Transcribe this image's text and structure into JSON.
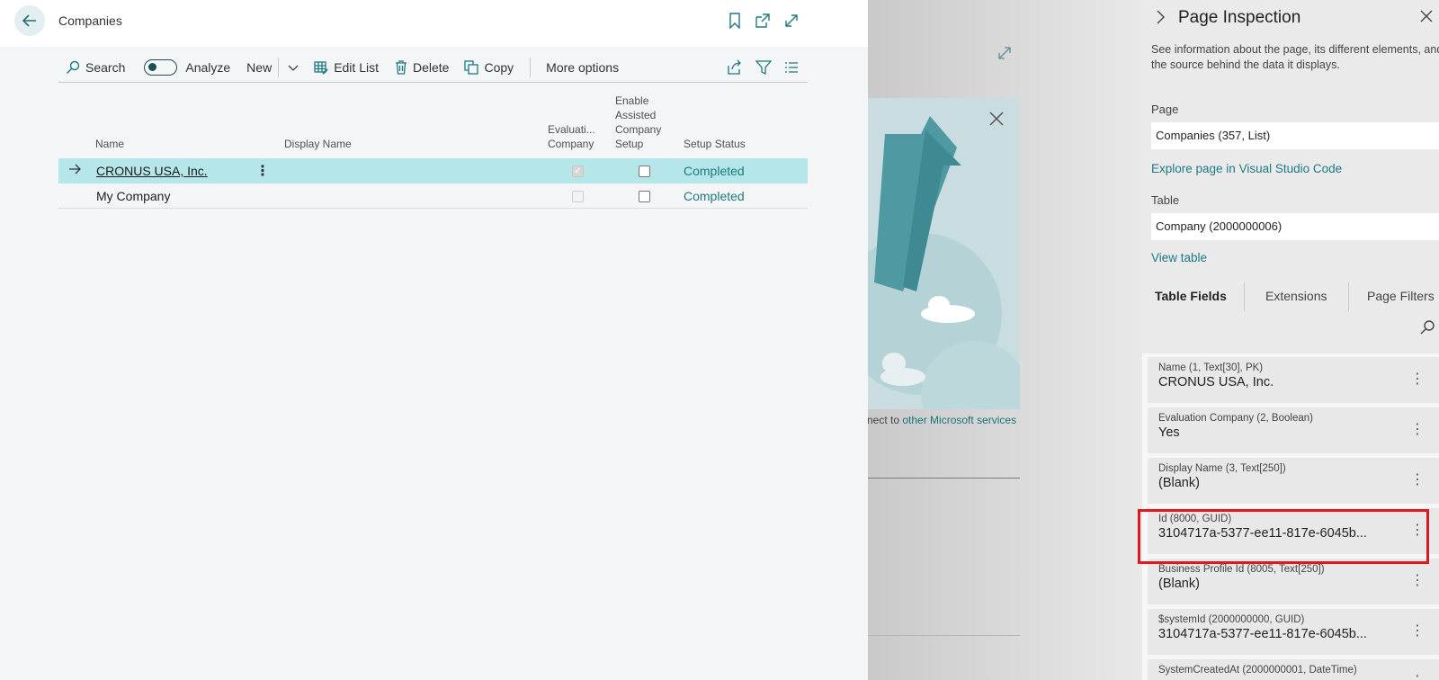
{
  "companies_page": {
    "title": "Companies",
    "toolbar": {
      "search": "Search",
      "analyze": "Analyze",
      "new": "New",
      "edit_list": "Edit List",
      "delete": "Delete",
      "copy": "Copy",
      "more_options": "More options"
    },
    "columns": {
      "name": "Name",
      "display_name": "Display Name",
      "evaluation_company": [
        "Evaluati...",
        "Company"
      ],
      "enable_assisted": [
        "Enable",
        "Assisted",
        "Company",
        "Setup"
      ],
      "setup_status": "Setup Status"
    },
    "rows": [
      {
        "name": "CRONUS USA, Inc.",
        "display_name": "",
        "evaluation_company": true,
        "enable_assisted": false,
        "setup_status": "Completed",
        "selected": true
      },
      {
        "name": "My Company",
        "display_name": "",
        "evaluation_company": false,
        "enable_assisted": false,
        "setup_status": "Completed",
        "selected": false
      }
    ]
  },
  "background": {
    "partial_text": "nect to ",
    "link_text": "other Microsoft services"
  },
  "inspection": {
    "title": "Page Inspection",
    "description": "See information about the page, its different elements, and the source behind the data it displays.",
    "page_label": "Page",
    "page_value": "Companies (357, List)",
    "explore_link": "Explore page in Visual Studio Code",
    "table_label": "Table",
    "table_value": "Company (2000000006)",
    "view_table_link": "View table",
    "tabs": [
      "Table Fields",
      "Extensions",
      "Page Filters"
    ],
    "fields": [
      {
        "meta": "Name (1, Text[30], PK)",
        "value": "CRONUS USA, Inc."
      },
      {
        "meta": "Evaluation Company (2, Boolean)",
        "value": "Yes"
      },
      {
        "meta": "Display Name (3, Text[250])",
        "value": "(Blank)"
      },
      {
        "meta": "Id (8000, GUID)",
        "value": "3104717a-5377-ee11-817e-6045b..."
      },
      {
        "meta": "Business Profile Id (8005, Text[250])",
        "value": "(Blank)"
      },
      {
        "meta": "$systemId (2000000000, GUID)",
        "value": "3104717a-5377-ee11-817e-6045b..."
      },
      {
        "meta": "SystemCreatedAt (2000000001, DateTime)",
        "value": ""
      }
    ],
    "highlighted_field_index": 3
  },
  "colors": {
    "accent": "#1d7a83",
    "selected_row": "#b4e6ea",
    "highlight": "#e0191f"
  }
}
